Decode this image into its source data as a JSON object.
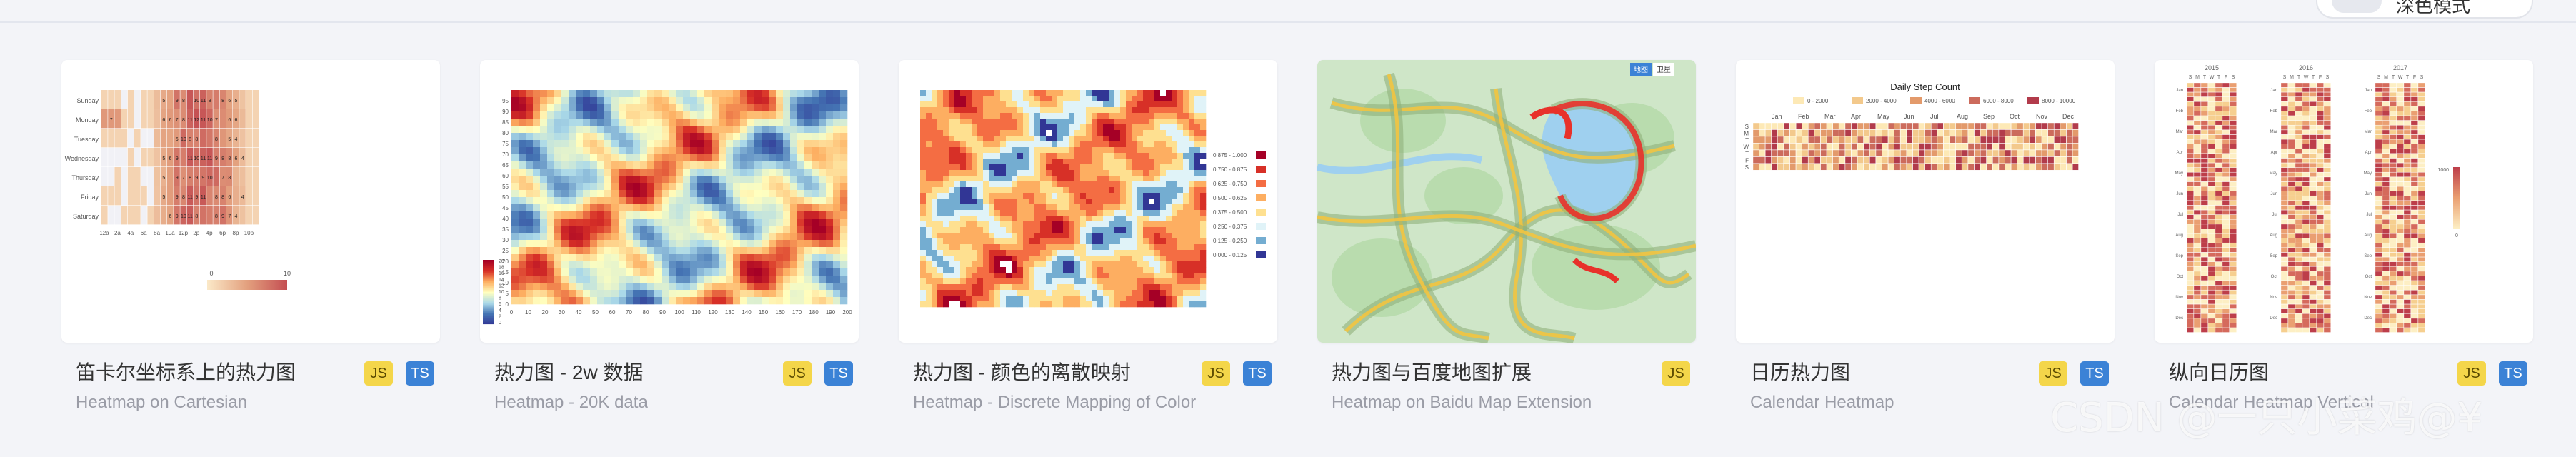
{
  "dark_mode_toggle": {
    "label": "深色模式",
    "state": "off"
  },
  "cards": [
    {
      "title": "笛卡尔坐标系上的热力图",
      "subtitle": "Heatmap on Cartesian",
      "badges": [
        "JS",
        "TS"
      ]
    },
    {
      "title": "热力图 - 2w 数据",
      "subtitle": "Heatmap - 20K data",
      "badges": [
        "JS",
        "TS"
      ]
    },
    {
      "title": "热力图 - 颜色的离散映射",
      "subtitle": "Heatmap - Discrete Mapping of Color",
      "badges": [
        "JS",
        "TS"
      ]
    },
    {
      "title": "热力图与百度地图扩展",
      "subtitle": "Heatmap on Baidu Map Extension",
      "badges": [
        "JS"
      ]
    },
    {
      "title": "日历热力图",
      "subtitle": "Calendar Heatmap",
      "badges": [
        "JS",
        "TS"
      ]
    },
    {
      "title": "纵向日历图",
      "subtitle": "Calendar Heatmap Vertical",
      "badges": [
        "JS",
        "TS"
      ]
    }
  ],
  "thumbnails": {
    "cartesian": {
      "days": [
        "Sunday",
        "Monday",
        "Tuesday",
        "Wednesday",
        "Thursday",
        "Friday",
        "Saturday"
      ],
      "hours": [
        "12a",
        "2a",
        "4a",
        "6a",
        "8a",
        "10a",
        "12p",
        "2p",
        "4p",
        "6p",
        "8p",
        "10p"
      ],
      "legend_min": "0",
      "legend_max": "10"
    },
    "k20": {
      "y_ticks": [
        "0",
        "5",
        "10",
        "15",
        "20",
        "25",
        "30",
        "35",
        "40",
        "45",
        "50",
        "55",
        "60",
        "65",
        "70",
        "75",
        "80",
        "85",
        "90",
        "95"
      ],
      "x_ticks": [
        "0",
        "10",
        "20",
        "30",
        "40",
        "50",
        "60",
        "70",
        "80",
        "90",
        "100",
        "110",
        "120",
        "130",
        "140",
        "150",
        "160",
        "170",
        "180",
        "190",
        "200"
      ],
      "legend_ticks": [
        "20",
        "18",
        "16",
        "14",
        "12",
        "10",
        "8",
        "6",
        "4",
        "2",
        "0"
      ]
    },
    "discrete": {
      "legend": [
        "0.875 - 1.000",
        "0.750 - 0.875",
        "0.625 - 0.750",
        "0.500 - 0.625",
        "0.375 - 0.500",
        "0.250 - 0.375",
        "0.125 - 0.250",
        "0.000 - 0.125"
      ],
      "legend_colors": [
        "#a50026",
        "#d73027",
        "#f46d43",
        "#fdae61",
        "#fee090",
        "#e0f3f8",
        "#74add1",
        "#313695"
      ]
    },
    "baidu": {
      "buttons": [
        "地图",
        "卫星"
      ]
    },
    "calendar": {
      "title": "Daily Step Count",
      "legend": [
        "0 - 2000",
        "2000 - 4000",
        "4000 - 6000",
        "6000 - 8000",
        "8000 - 10000"
      ],
      "months": [
        "Jan",
        "Feb",
        "Mar",
        "Apr",
        "May",
        "Jun",
        "Jul",
        "Aug",
        "Sep",
        "Oct",
        "Nov",
        "Dec"
      ],
      "weekdays": [
        "S",
        "M",
        "T",
        "W",
        "T",
        "F",
        "S"
      ]
    },
    "vertical": {
      "years": [
        "2015",
        "2016",
        "2017"
      ],
      "weekdays": [
        "S",
        "M",
        "T",
        "W",
        "T",
        "F",
        "S"
      ],
      "months": [
        "Jan",
        "Feb",
        "Mar",
        "Apr",
        "May",
        "Jun",
        "Jul",
        "Aug",
        "Sep",
        "Oct",
        "Nov",
        "Dec"
      ],
      "legend_max": "1000",
      "legend_min": "0"
    }
  },
  "watermark": "CSDN @一只小菜鸡@¥"
}
